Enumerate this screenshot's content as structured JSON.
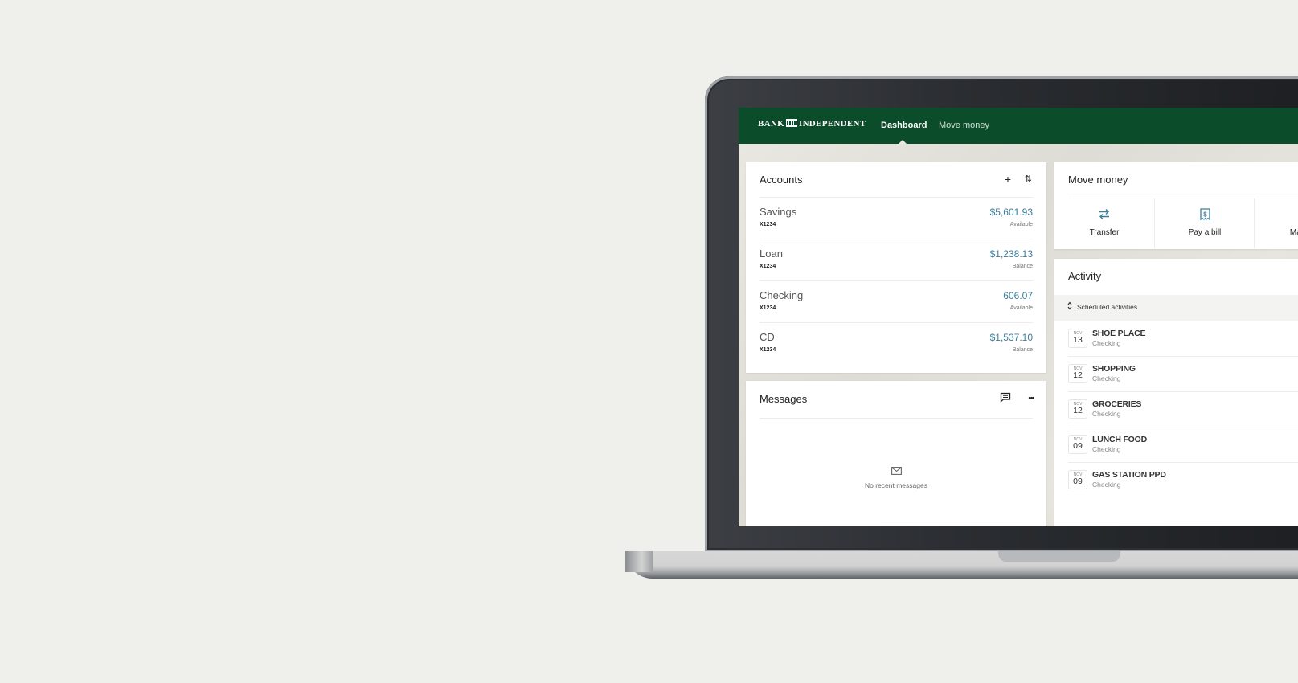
{
  "nav": {
    "logo_left": "BANK",
    "logo_icon": "bank-building-icon",
    "logo_right": "INDEPENDENT",
    "items": [
      {
        "label": "Dashboard",
        "active": true
      },
      {
        "label": "Move money",
        "active": false
      }
    ]
  },
  "accounts": {
    "title": "Accounts",
    "add_icon": "+",
    "sort_icon": "⇅",
    "items": [
      {
        "name": "Savings",
        "number": "X1234",
        "amount": "$5,601.93",
        "label": "Available"
      },
      {
        "name": "Loan",
        "number": "X1234",
        "amount": "$1,238.13",
        "label": "Balance"
      },
      {
        "name": "Checking",
        "number": "X1234",
        "amount": "606.07",
        "label": "Available"
      },
      {
        "name": "CD",
        "number": "X1234",
        "amount": "$1,537.10",
        "label": "Balance"
      }
    ]
  },
  "messages": {
    "title": "Messages",
    "more_icon": "•••",
    "empty_text": "No recent messages"
  },
  "move_money": {
    "title": "Move money",
    "actions": [
      {
        "label": "Transfer",
        "icon": "⇄"
      },
      {
        "label": "Pay a bill",
        "icon": "$"
      },
      {
        "label": "Manage",
        "icon": ""
      }
    ]
  },
  "activity": {
    "title": "Activity",
    "scheduled_label": "Scheduled activities",
    "scheduled_icon": "⌃⌄",
    "items": [
      {
        "month": "NOV",
        "day": "13",
        "name": "SHOE PLACE",
        "account": "Checking"
      },
      {
        "month": "NOV",
        "day": "12",
        "name": "SHOPPING",
        "account": "Checking"
      },
      {
        "month": "NOV",
        "day": "12",
        "name": "GROCERIES",
        "account": "Checking"
      },
      {
        "month": "NOV",
        "day": "09",
        "name": "LUNCH FOOD",
        "account": "Checking"
      },
      {
        "month": "NOV",
        "day": "09",
        "name": "GAS STATION PPD",
        "account": "Checking"
      }
    ]
  },
  "colors": {
    "brand_green": "#0b4d2a",
    "amount_blue": "#3e7d9a",
    "background": "#efefeb"
  }
}
